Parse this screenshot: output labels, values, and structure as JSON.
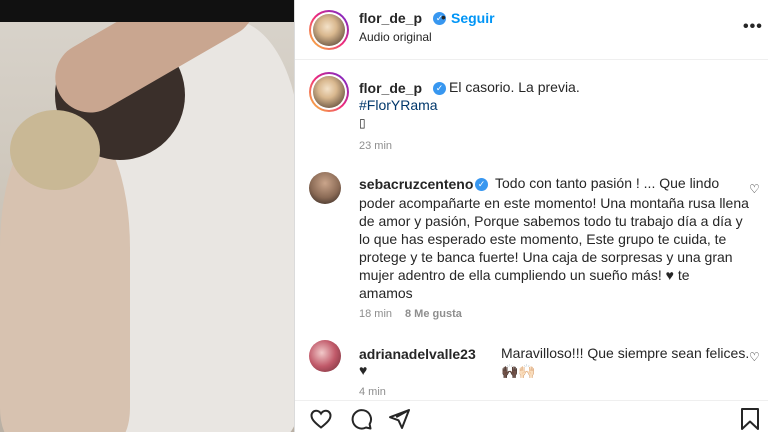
{
  "header": {
    "username": "flor_de_p",
    "dot": "•",
    "follow_label": "Seguir",
    "audio_label": "Audio original",
    "more_icon": "more-dots-icon"
  },
  "caption": {
    "username": "flor_de_p",
    "text": "El casorio. La previa.",
    "hashtag": "#FlorYRama",
    "glyph": "▯",
    "time": "23 min"
  },
  "comments": [
    {
      "username": "sebacruzcenteno",
      "verified": true,
      "lines": [
        "Todo con tanto pasión ! ... Que lindo",
        "poder acompañarte en este momento! Una montaña rusa llena",
        "de amor y pasión, Porque sabemos todo tu trabajo día a día y",
        "lo que has esperado este momento, Este grupo te cuida, te",
        "protege y te banca fuerte! Una caja de sorpresas y una gran",
        "mujer adentro de ella cumpliendo un sueño más! ♥ te",
        "amamos"
      ],
      "time": "18 min",
      "likes": "8 Me gusta"
    },
    {
      "username": "adrianadelvalle23",
      "verified": false,
      "lines": [
        "Maravilloso!!! Que siempre sean felices. 🙌🏿🙌🏻",
        "♥"
      ],
      "time": "4 min"
    }
  ],
  "colors": {
    "accent": "#0095f6",
    "verified": "#3897f0",
    "text": "#262626",
    "muted": "#8e8e8e"
  }
}
